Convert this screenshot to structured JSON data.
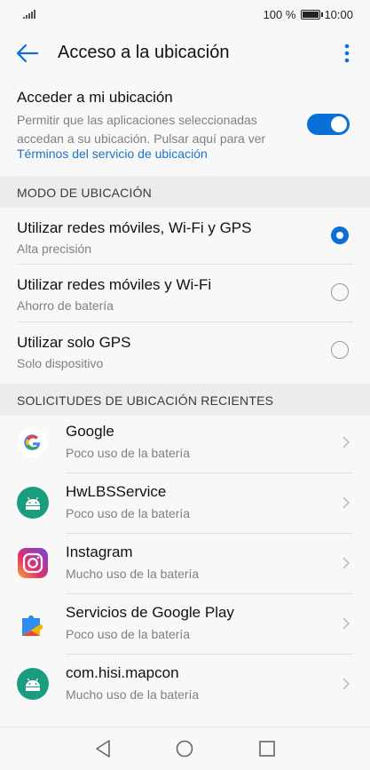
{
  "status_bar": {
    "battery_percent": "100 %",
    "time": "10:00"
  },
  "header": {
    "title": "Acceso a la ubicación"
  },
  "location_access": {
    "title": "Acceder a mi ubicación",
    "description": "Permitir que las aplicaciones seleccionadas accedan a su ubicación. Pulsar aquí para ver",
    "link": "Términos del servicio de ubicación",
    "enabled": true
  },
  "mode_section": {
    "header": "MODO DE UBICACIÓN",
    "options": [
      {
        "title": "Utilizar redes móviles, Wi-Fi y GPS",
        "subtitle": "Alta precisión",
        "selected": true
      },
      {
        "title": "Utilizar redes móviles y Wi-Fi",
        "subtitle": "Ahorro de batería",
        "selected": false
      },
      {
        "title": "Utilizar solo GPS",
        "subtitle": "Solo dispositivo",
        "selected": false
      }
    ]
  },
  "recent_section": {
    "header": "SOLICITUDES DE UBICACIÓN RECIENTES",
    "apps": [
      {
        "name": "Google",
        "usage": "Poco uso de la batería",
        "icon": "google-g-icon"
      },
      {
        "name": "HwLBSService",
        "usage": "Poco uso de la batería",
        "icon": "android-icon"
      },
      {
        "name": "Instagram",
        "usage": "Mucho uso de la batería",
        "icon": "instagram-icon"
      },
      {
        "name": "Servicios de Google Play",
        "usage": "Poco uso de la batería",
        "icon": "puzzle-icon"
      },
      {
        "name": "com.hisi.mapcon",
        "usage": "Mucho uso de la batería",
        "icon": "android-icon"
      }
    ]
  },
  "colors": {
    "accent": "#0a6fd6",
    "link": "#1a73c9",
    "android_green": "#1a9d7f"
  }
}
